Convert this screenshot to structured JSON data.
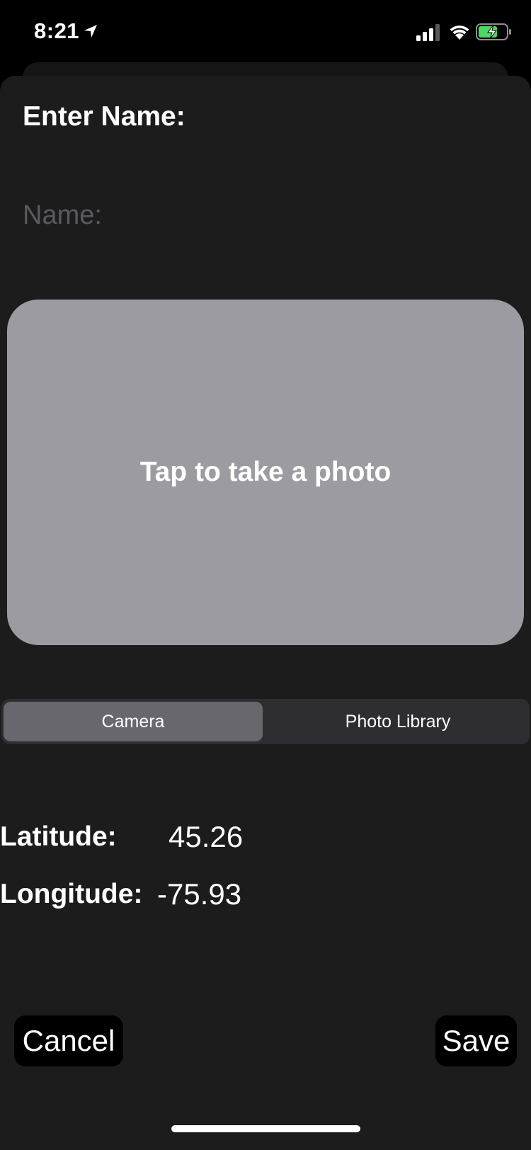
{
  "status_bar": {
    "time": "8:21",
    "icons": [
      "location-arrow-icon",
      "cellular-signal-icon",
      "wifi-icon",
      "battery-charging-icon"
    ],
    "battery_color": "#4cd964"
  },
  "form": {
    "title": "Enter Name:",
    "name_input": {
      "value": "",
      "placeholder": "Name:"
    }
  },
  "photo": {
    "label": "Tap to take a photo",
    "background_color": "#9c9ba1"
  },
  "source_selector": {
    "options": [
      "Camera",
      "Photo Library"
    ],
    "selected": "Camera"
  },
  "location": {
    "latitude_label": "Latitude:",
    "latitude_value": "45.26",
    "longitude_label": "Longitude:",
    "longitude_value": "-75.93"
  },
  "actions": {
    "cancel_label": "Cancel",
    "save_label": "Save"
  }
}
